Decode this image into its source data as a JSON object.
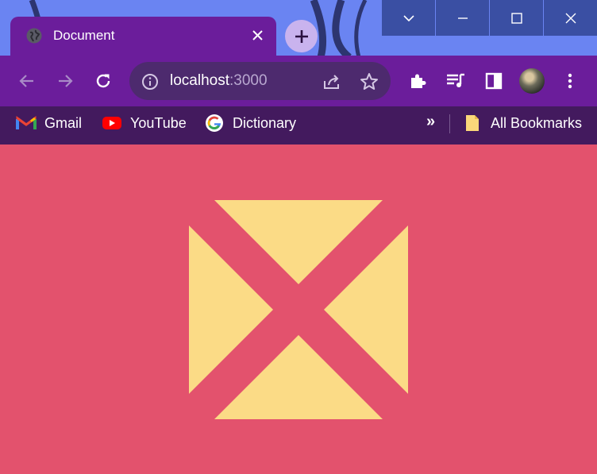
{
  "window": {
    "controls": [
      "tab-search",
      "minimize",
      "maximize",
      "close"
    ]
  },
  "tab": {
    "title": "Document",
    "favicon": "globe-icon"
  },
  "toolbar": {
    "url_host": "localhost",
    "url_port": ":3000"
  },
  "bookmarks": {
    "items": [
      {
        "label": "Gmail",
        "icon": "gmail-icon"
      },
      {
        "label": "YouTube",
        "icon": "youtube-icon"
      },
      {
        "label": "Dictionary",
        "icon": "google-icon"
      }
    ],
    "overflow_label": "»",
    "all_bookmarks_label": "All Bookmarks"
  },
  "page": {
    "background_color": "#e3526d",
    "shape_color": "#fbdb86",
    "shape_description": "four triangles forming an X cut-out inside a square"
  },
  "colors": {
    "browser_frame": "#6b1d9b",
    "bookmarks_bar": "#431a5e",
    "caption_buttons": "#3a4fa3"
  }
}
